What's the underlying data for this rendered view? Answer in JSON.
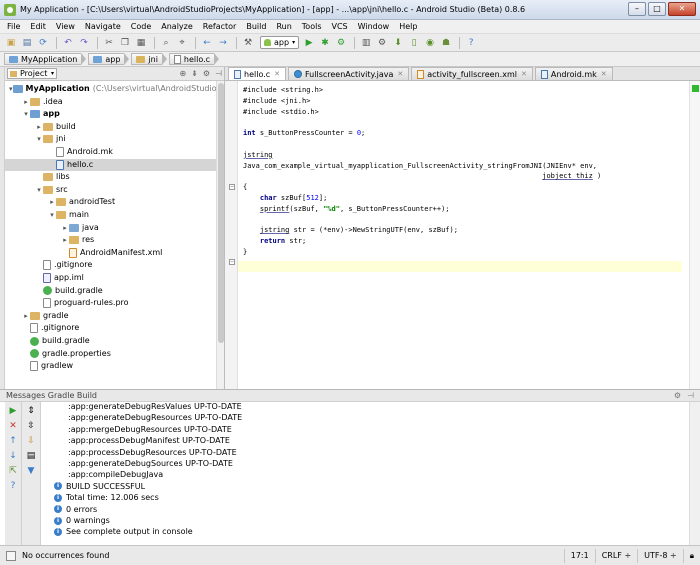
{
  "window": {
    "title": "My Application - [C:\\Users\\virtual\\AndroidStudioProjects\\MyApplication] - [app] - ...\\app\\jni\\hello.c - Android Studio (Beta) 0.8.6"
  },
  "menu": [
    "File",
    "Edit",
    "View",
    "Navigate",
    "Code",
    "Analyze",
    "Refactor",
    "Build",
    "Run",
    "Tools",
    "VCS",
    "Window",
    "Help"
  ],
  "toolbar": {
    "run_config": "app"
  },
  "breadcrumbs": [
    "MyApplication",
    "app",
    "jni",
    "hello.c"
  ],
  "project": {
    "view_label": "Project",
    "tree": [
      {
        "label": "MyApplication",
        "path": "(C:\\Users\\virtual\\AndroidStudioProjects",
        "icon": "mod",
        "depth": 0,
        "arrow": "▾",
        "bold": true
      },
      {
        "label": ".idea",
        "icon": "folder",
        "depth": 1,
        "arrow": "▸"
      },
      {
        "label": "app",
        "icon": "mod",
        "depth": 1,
        "arrow": "▾",
        "bold": true
      },
      {
        "label": "build",
        "icon": "folder",
        "depth": 2,
        "arrow": "▸"
      },
      {
        "label": "jni",
        "icon": "folder",
        "depth": 2,
        "arrow": "▾"
      },
      {
        "label": "Android.mk",
        "icon": "file",
        "depth": 3,
        "arrow": ""
      },
      {
        "label": "hello.c",
        "icon": "cfile",
        "depth": 3,
        "arrow": "",
        "selected": true
      },
      {
        "label": "libs",
        "icon": "folder",
        "depth": 2,
        "arrow": ""
      },
      {
        "label": "src",
        "icon": "folder",
        "depth": 2,
        "arrow": "▾"
      },
      {
        "label": "androidTest",
        "icon": "folder",
        "depth": 3,
        "arrow": "▸"
      },
      {
        "label": "main",
        "icon": "folder",
        "depth": 3,
        "arrow": "▾"
      },
      {
        "label": "java",
        "icon": "src",
        "depth": 4,
        "arrow": "▸"
      },
      {
        "label": "res",
        "icon": "folder",
        "depth": 4,
        "arrow": "▸"
      },
      {
        "label": "AndroidManifest.xml",
        "icon": "xml",
        "depth": 4,
        "arrow": ""
      },
      {
        "label": ".gitignore",
        "icon": "file",
        "depth": 2,
        "arrow": ""
      },
      {
        "label": "app.iml",
        "icon": "iml",
        "depth": 2,
        "arrow": ""
      },
      {
        "label": "build.gradle",
        "icon": "gradle",
        "depth": 2,
        "arrow": ""
      },
      {
        "label": "proguard-rules.pro",
        "icon": "file",
        "depth": 2,
        "arrow": ""
      },
      {
        "label": "gradle",
        "icon": "folder",
        "depth": 1,
        "arrow": "▸"
      },
      {
        "label": ".gitignore",
        "icon": "file",
        "depth": 1,
        "arrow": ""
      },
      {
        "label": "build.gradle",
        "icon": "gradle",
        "depth": 1,
        "arrow": ""
      },
      {
        "label": "gradle.properties",
        "icon": "gradle",
        "depth": 1,
        "arrow": ""
      },
      {
        "label": "gradlew",
        "icon": "file",
        "depth": 1,
        "arrow": ""
      }
    ]
  },
  "editor": {
    "tabs": [
      {
        "label": "hello.c",
        "type": "c",
        "active": true
      },
      {
        "label": "FullscreenActivity.java",
        "type": "java"
      },
      {
        "label": "activity_fullscreen.xml",
        "type": "xml"
      },
      {
        "label": "Android.mk",
        "type": "c"
      }
    ],
    "code_lines": [
      "#include <string.h>",
      "#include <jni.h>",
      "#include <stdio.h>",
      "",
      "int s_ButtonPressCounter = 0;",
      "",
      "jstring",
      "Java_com_example_virtual_myapplication_FullscreenActivity_stringFromJNI(JNIEnv* env,",
      "                                                                       jobject thiz )",
      "{",
      "    char szBuf[512];",
      "    sprintf(szBuf, \"%d\", s_ButtonPressCounter++);",
      "",
      "    jstring str = (*env)->NewStringUTF(env, szBuf);",
      "    return str;",
      "}"
    ]
  },
  "messages": {
    "header": "Messages Gradle Build",
    "lines": [
      {
        "text": ":app:generateDebugResValues UP-TO-DATE",
        "info": false
      },
      {
        "text": ":app:generateDebugResources UP-TO-DATE",
        "info": false
      },
      {
        "text": ":app:mergeDebugResources UP-TO-DATE",
        "info": false
      },
      {
        "text": ":app:processDebugManifest UP-TO-DATE",
        "info": false
      },
      {
        "text": ":app:processDebugResources UP-TO-DATE",
        "info": false
      },
      {
        "text": ":app:generateDebugSources UP-TO-DATE",
        "info": false
      },
      {
        "text": ":app:compileDebugJava",
        "info": false
      },
      {
        "text": "BUILD SUCCESSFUL",
        "info": true
      },
      {
        "text": "Total time: 12.006 secs",
        "info": true
      },
      {
        "text": "0 errors",
        "info": true
      },
      {
        "text": "0 warnings",
        "info": true
      },
      {
        "text": "See complete output in console",
        "info": true
      }
    ]
  },
  "status": {
    "message": "No occurrences found",
    "position": "17:1",
    "line_sep": "CRLF ÷",
    "encoding": "UTF-8 ÷"
  }
}
